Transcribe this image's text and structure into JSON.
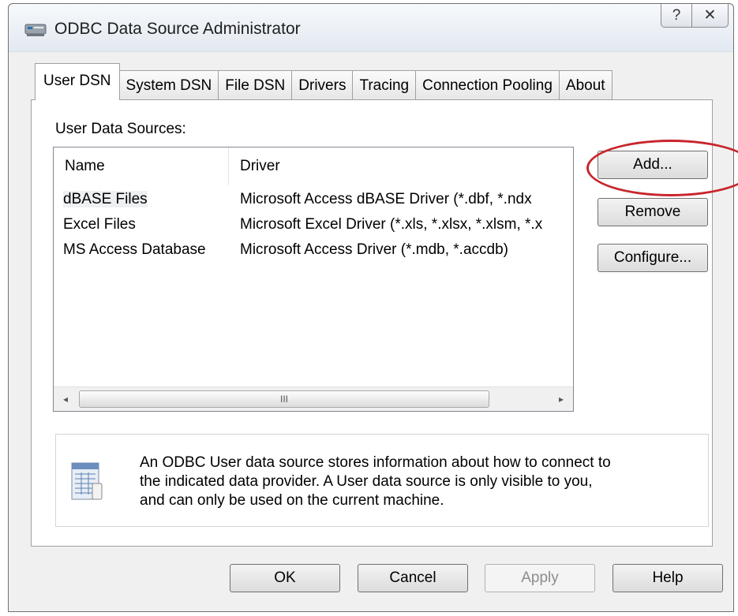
{
  "window": {
    "title": "ODBC Data Source Administrator",
    "help_glyph": "?",
    "close_glyph": "✕"
  },
  "tabs": [
    {
      "label": "User DSN",
      "active": true
    },
    {
      "label": "System DSN",
      "active": false
    },
    {
      "label": "File DSN",
      "active": false
    },
    {
      "label": "Drivers",
      "active": false
    },
    {
      "label": "Tracing",
      "active": false
    },
    {
      "label": "Connection Pooling",
      "active": false
    },
    {
      "label": "About",
      "active": false
    }
  ],
  "panel": {
    "section_label": "User Data Sources:",
    "columns": {
      "name": "Name",
      "driver": "Driver"
    },
    "rows": [
      {
        "name": "dBASE Files",
        "driver": "Microsoft Access dBASE Driver (*.dbf, *.ndx"
      },
      {
        "name": "Excel Files",
        "driver": "Microsoft Excel Driver (*.xls, *.xlsx, *.xlsm, *.x"
      },
      {
        "name": "MS Access Database",
        "driver": "Microsoft Access Driver (*.mdb, *.accdb)"
      }
    ],
    "scroll_left": "◂",
    "scroll_right": "▸",
    "scroll_grip": "III",
    "buttons": {
      "add": "Add...",
      "remove": "Remove",
      "configure": "Configure..."
    },
    "info_lines": [
      "An ODBC User data source stores information about how to connect to",
      "the indicated data provider.  A User data source is only visible to you,",
      "and can only be used on the current machine."
    ]
  },
  "footer": {
    "ok": "OK",
    "cancel": "Cancel",
    "apply": "Apply",
    "help": "Help"
  },
  "colors": {
    "highlight_ellipse": "#c8252c"
  }
}
